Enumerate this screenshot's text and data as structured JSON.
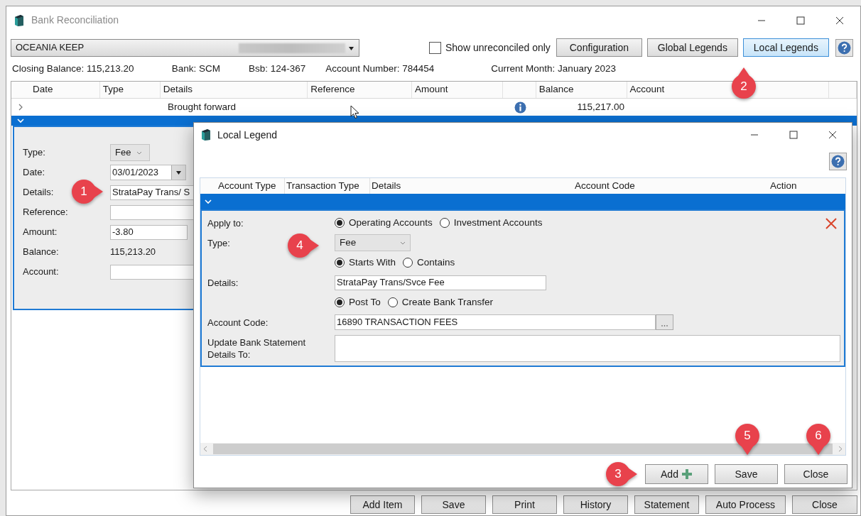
{
  "window": {
    "title": "Bank Reconciliation"
  },
  "account_select": {
    "value": "OCEANIA KEEP"
  },
  "show_unreconciled": {
    "label": "Show unreconciled only",
    "checked": false
  },
  "toolbar_buttons": [
    {
      "label": "Configuration",
      "selected": false
    },
    {
      "label": "Global Legends",
      "selected": false
    },
    {
      "label": "Local Legends",
      "selected": true
    }
  ],
  "info": [
    "Closing Balance: 115,213.20",
    "Bank: SCM",
    "Bsb: 124-367",
    "Account Number: 784454",
    "Current Month: January 2023"
  ],
  "table": {
    "columns": [
      "Date",
      "Type",
      "Details",
      "Reference",
      "Amount",
      "Balance",
      "Account"
    ],
    "rows": [
      {
        "expanded": false,
        "details": "Brought forward",
        "balance": "115,217.00"
      },
      {
        "expanded": true
      }
    ],
    "editor": [
      {
        "kind": "dropdown",
        "label": "Type:",
        "value": "Fee"
      },
      {
        "kind": "date",
        "label": "Date:",
        "value": "03/01/2023"
      },
      {
        "kind": "text",
        "label": "Details:",
        "value": "StrataPay Trans/ S"
      },
      {
        "kind": "text",
        "label": "Reference:"
      },
      {
        "kind": "short",
        "label": "Amount:",
        "value": "-3.80"
      },
      {
        "kind": "static",
        "label": "Balance:",
        "value": "115,213.20"
      },
      {
        "kind": "text",
        "label": "Account:"
      }
    ]
  },
  "footer_buttons": [
    "Add Item",
    "Save",
    "Print",
    "History",
    "Statement",
    "Auto Process",
    "Close"
  ],
  "dialog": {
    "title": "Local Legend",
    "columns": [
      "Account Type",
      "Transaction Type",
      "Details",
      "Account Code",
      "Action"
    ],
    "expanded": true,
    "form": [
      {
        "kind": "radios",
        "label": "Apply to:",
        "options": [
          {
            "label": "Operating Accounts",
            "selected": true
          },
          {
            "label": "Investment Accounts",
            "selected": false
          }
        ]
      },
      {
        "kind": "dropdown",
        "label": "Type:",
        "value": "Fee"
      },
      {
        "kind": "radios",
        "options": [
          {
            "label": "Starts With",
            "selected": true
          },
          {
            "label": "Contains",
            "selected": false
          }
        ]
      },
      {
        "kind": "text",
        "label": "Details:",
        "value": "StrataPay Trans/Svce Fee"
      },
      {
        "kind": "radios",
        "options": [
          {
            "label": "Post To",
            "selected": true
          },
          {
            "label": "Create Bank Transfer",
            "selected": false
          }
        ]
      },
      {
        "kind": "lookup",
        "label": "Account Code:",
        "value": "16890 TRANSACTION FEES"
      },
      {
        "kind": "textarea",
        "label": "Update Bank Statement Details To:"
      }
    ],
    "buttons": [
      "Add",
      "Save",
      "Close"
    ]
  },
  "callouts": [
    {
      "number": "1",
      "kind": "right"
    },
    {
      "number": "2",
      "kind": "up"
    },
    {
      "number": "3",
      "kind": "right"
    },
    {
      "number": "4",
      "kind": "right"
    },
    {
      "number": "5",
      "kind": "down"
    },
    {
      "number": "6",
      "kind": "down"
    }
  ]
}
